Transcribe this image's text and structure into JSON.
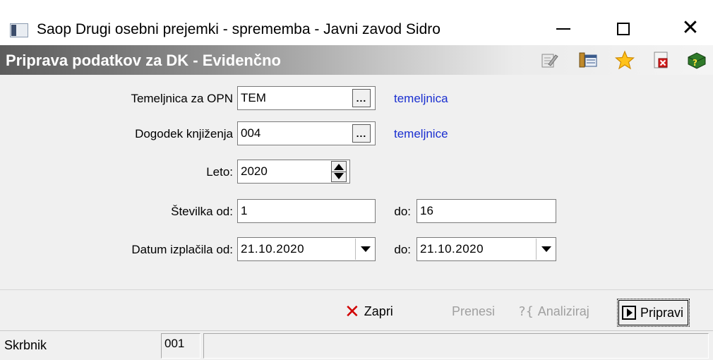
{
  "window": {
    "title": "Saop  Drugi osebni prejemki  - sprememba - Javni zavod Sidro",
    "minimize_icon": "minimize-icon",
    "maximize_icon": "maximize-icon",
    "close_icon": "close-icon",
    "close_glyph": "✕"
  },
  "header": {
    "title": "Priprava podatkov za DK - Evidenčno",
    "toolbar_icons": [
      "edit-icon",
      "list-icon",
      "star-icon",
      "export-icon",
      "help-icon"
    ]
  },
  "form": {
    "temeljnica": {
      "label": "Temeljnica za OPN",
      "value": "TEM",
      "button": "...",
      "link": "temeljnica"
    },
    "dogodek": {
      "label": "Dogodek knjiženja",
      "value": "004",
      "button": "...",
      "link": "temeljnice"
    },
    "leto": {
      "label": "Leto:",
      "value": "2020"
    },
    "stevilka": {
      "label": "Številka od:",
      "from": "1",
      "to_label": "do:",
      "to": "16"
    },
    "datum": {
      "label": "Datum izplačila od:",
      "from": "21.10.2020",
      "to_label": "do:",
      "to": "21.10.2020"
    }
  },
  "actions": {
    "zapri": "Zapri",
    "prenesi": "Prenesi",
    "analiziraj_icon": "?{",
    "analiziraj": "Analiziraj",
    "pripravi": "Pripravi"
  },
  "status": {
    "user": "Skrbnik",
    "code": "001",
    "message": ""
  },
  "colors": {
    "link": "#1a2fd0",
    "close_accent": "#d10000",
    "disabled_text": "#a0a0a0"
  }
}
